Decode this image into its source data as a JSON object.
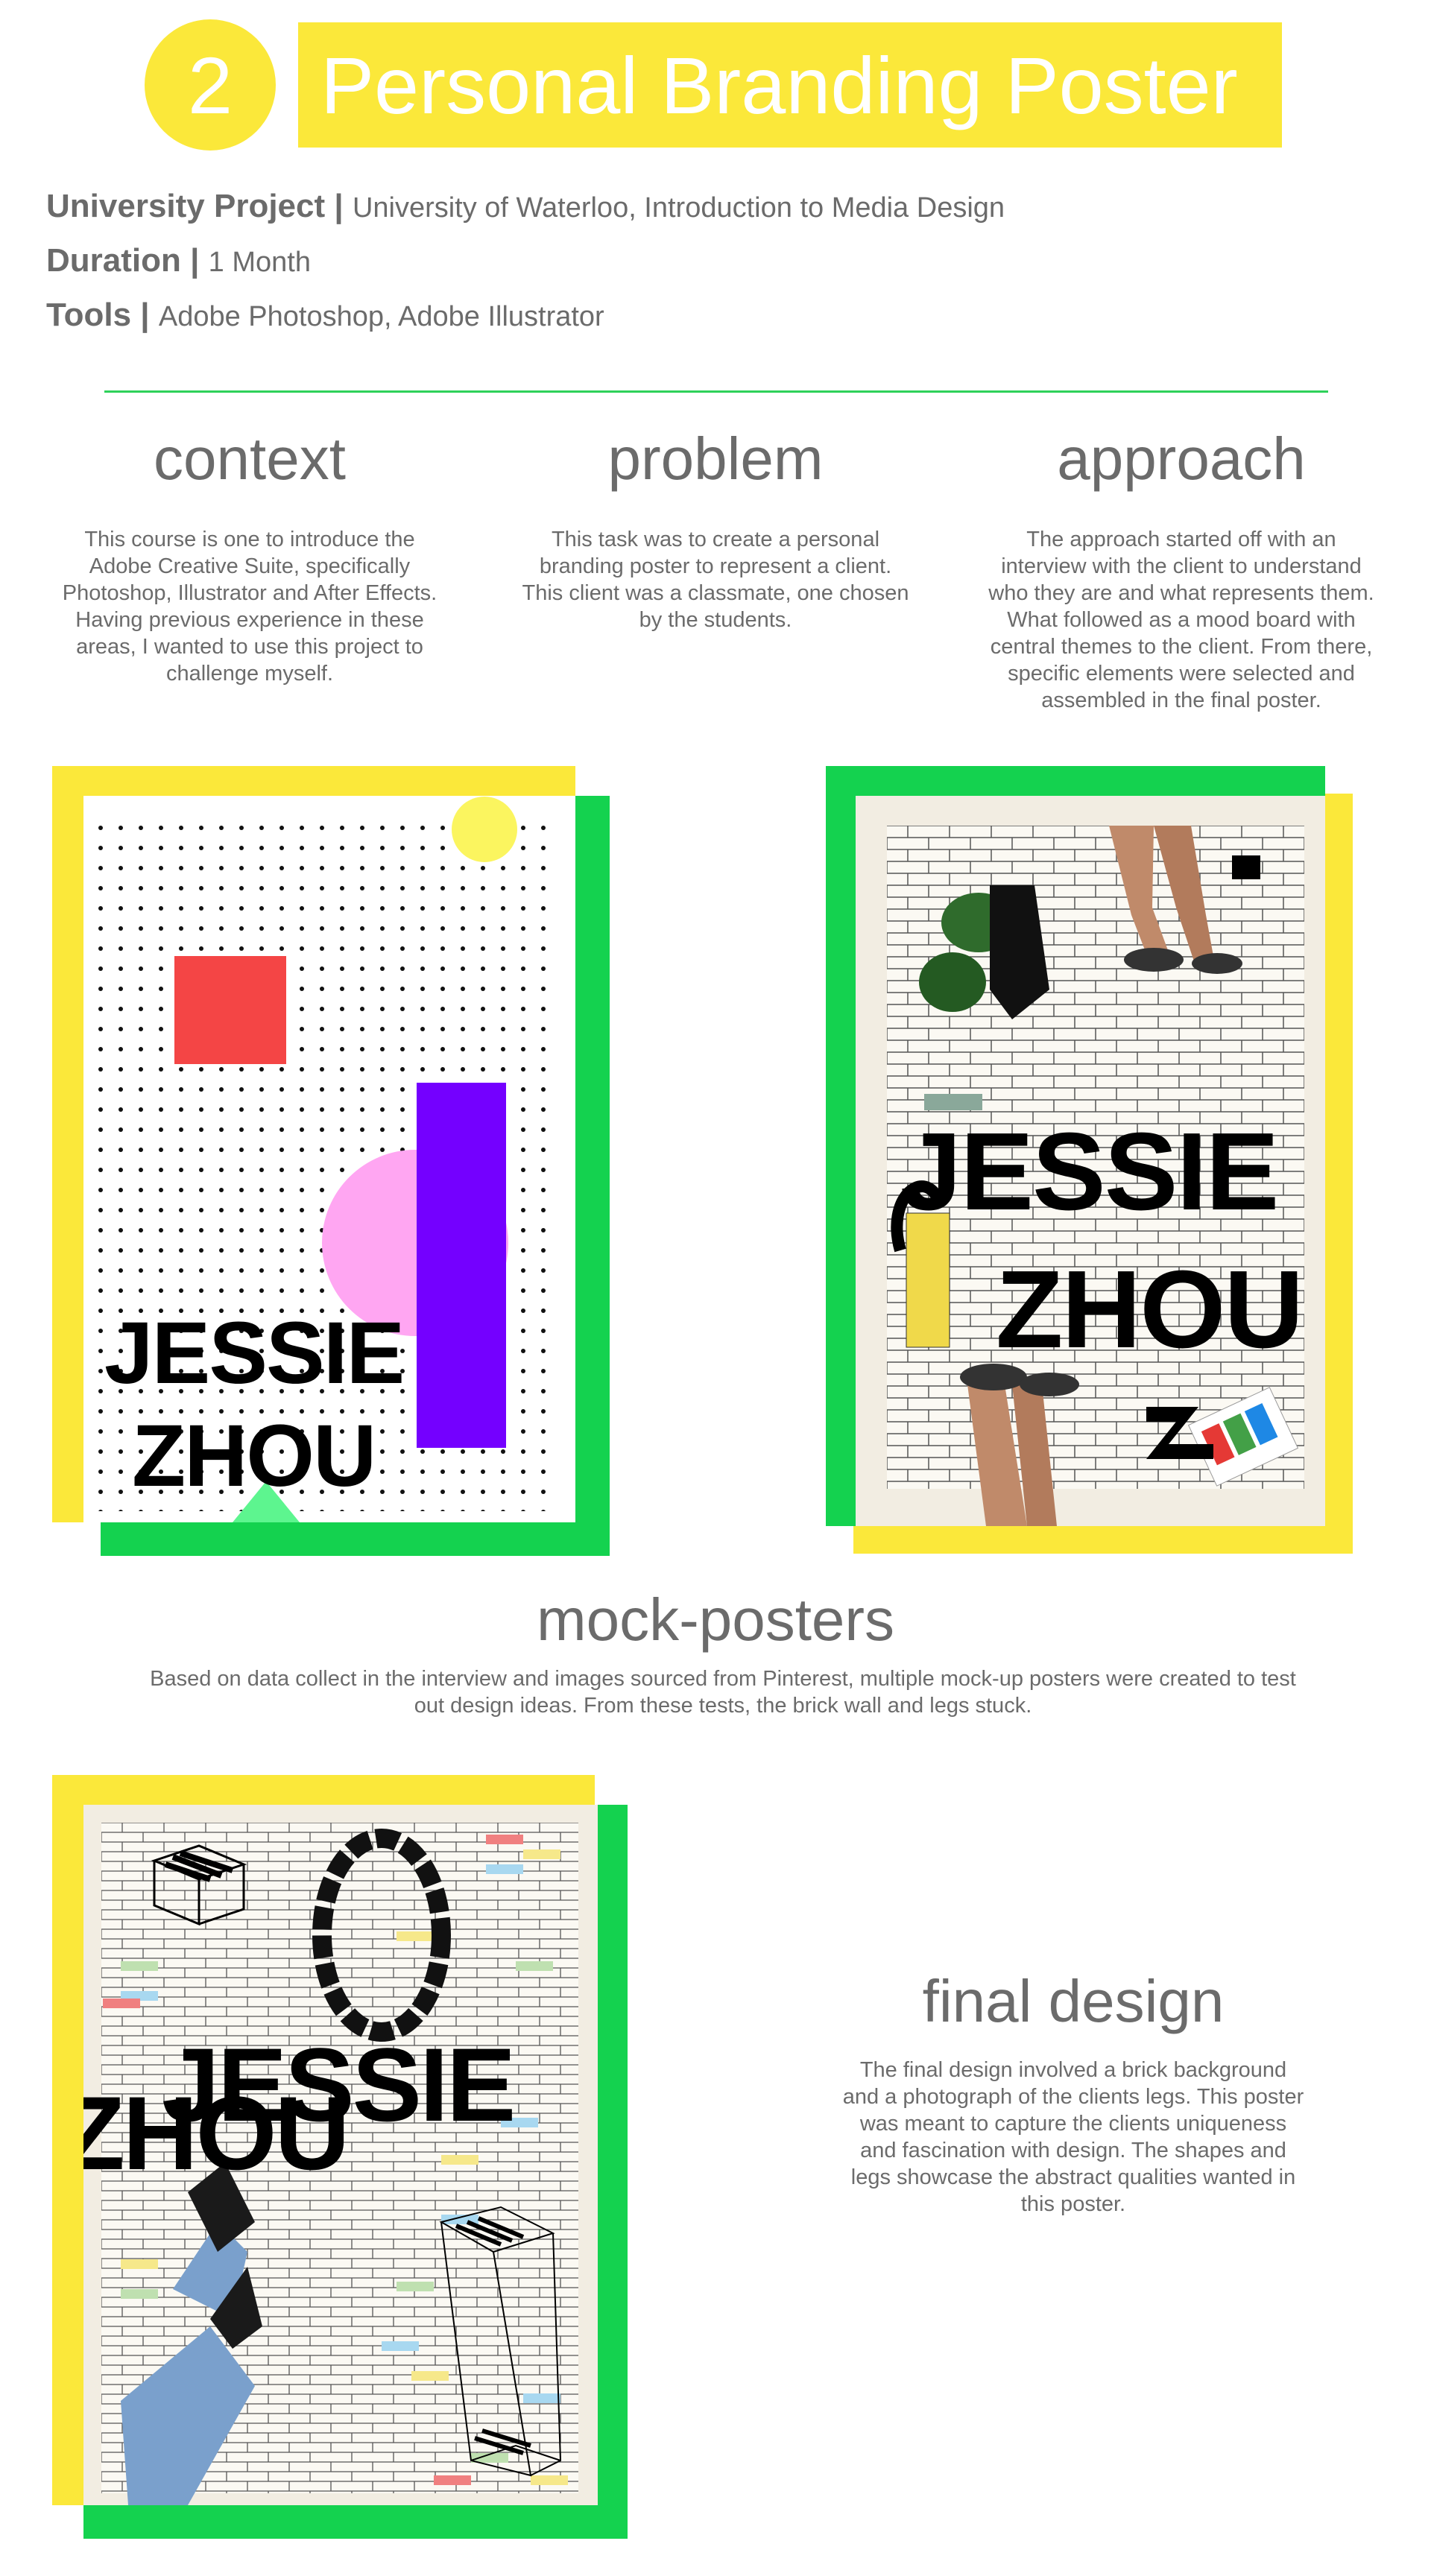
{
  "header": {
    "number": "2",
    "title": "Personal Branding Poster"
  },
  "meta": {
    "project_label": "University Project",
    "project_value": "University of Waterloo, Introduction to Media Design",
    "duration_label": "Duration",
    "duration_value": "1 Month",
    "tools_label": "Tools",
    "tools_value": "Adobe Photoshop, Adobe Illustrator",
    "separator": "|"
  },
  "columns": [
    {
      "heading": "context",
      "text": "This course is one to introduce the Adobe Creative Suite, specifically Photoshop, Illustrator and After Effects. Having previous experience in these areas, I wanted to use this project to challenge myself."
    },
    {
      "heading": "problem",
      "text": "This task was to create a personal branding poster to represent a client. This client was a classmate, one chosen by the students."
    },
    {
      "heading": "approach",
      "text": "The approach started off with an interview with the client to understand who they are and what represents them. What followed as a mood board with central themes to the client. From there, specific elements were selected and assembled in the final poster."
    }
  ],
  "posters": {
    "name_first": "JESSIE",
    "name_last": "ZHOU"
  },
  "mock_posters": {
    "heading": "mock-posters",
    "text": "Based on data collect in the interview and images sourced from Pinterest, multiple mock-up posters were created to test out design ideas. From these tests, the brick wall and legs stuck."
  },
  "final_design": {
    "heading": "final design",
    "text": "The final design involved a brick background and a photograph of the clients legs. This poster was meant to capture the clients uniqueness and fascination with design. The shapes and legs showcase the abstract qualities wanted in this poster."
  },
  "colors": {
    "yellow": "#fbe83a",
    "green": "#14d24f",
    "red": "#f44545",
    "purple": "#7400ff",
    "pink": "#ffa6f2",
    "mint": "#5df58f",
    "text": "#6b6b6b"
  }
}
